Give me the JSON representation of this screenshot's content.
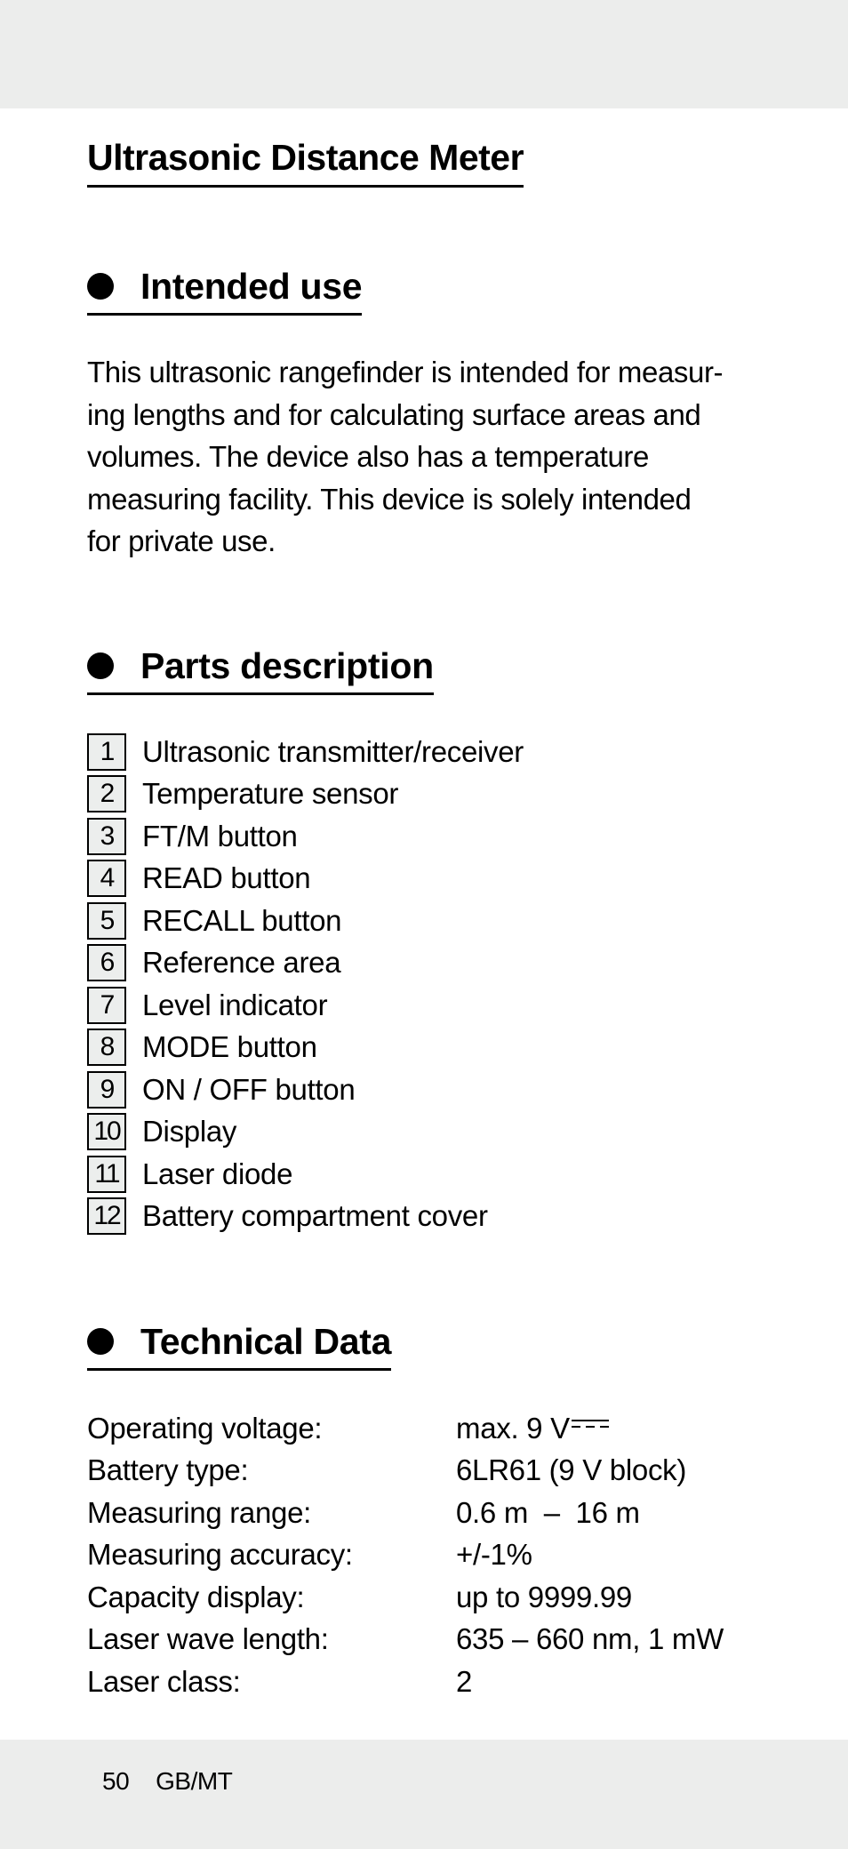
{
  "title": "Ultrasonic Distance Meter",
  "sections": {
    "intended_use": {
      "heading": "Intended use",
      "lines": [
        "This ultrasonic rangefinder is intended for measur-",
        "ing lengths and for calculating surface areas and",
        "volumes. The device also has a temperature",
        "measuring facility. This device is solely intended",
        "for private use."
      ]
    },
    "parts_description": {
      "heading": "Parts description",
      "items": [
        {
          "num": "1",
          "label": "Ultrasonic transmitter/receiver"
        },
        {
          "num": "2",
          "label": "Temperature sensor"
        },
        {
          "num": "3",
          "label": "FT/M button"
        },
        {
          "num": "4",
          "label": "READ button"
        },
        {
          "num": "5",
          "label": "RECALL button"
        },
        {
          "num": "6",
          "label": "Reference area"
        },
        {
          "num": "7",
          "label": "Level indicator"
        },
        {
          "num": "8",
          "label": "MODE button"
        },
        {
          "num": "9",
          "label": "ON / OFF button"
        },
        {
          "num": "10",
          "label": "Display"
        },
        {
          "num": "11",
          "label": "Laser diode"
        },
        {
          "num": "12",
          "label": "Battery compartment cover"
        }
      ]
    },
    "technical_data": {
      "heading": "Technical Data",
      "rows": [
        {
          "label": "Operating voltage:",
          "value": "max. 9 V",
          "icon": "dc-current-symbol"
        },
        {
          "label": "Battery type:",
          "value": "6LR61 (9 V block)"
        },
        {
          "label": "Measuring range:",
          "value": "0.6 m  –  16 m"
        },
        {
          "label": "Measuring accuracy:",
          "value": "+/-1%"
        },
        {
          "label": "Capacity display:",
          "value": "up to 9999.99"
        },
        {
          "label": "Laser wave length:",
          "value": "635 – 660 nm, 1 mW"
        },
        {
          "label": "Laser class:",
          "value": "2"
        }
      ]
    }
  },
  "footer": {
    "page_number": "50",
    "locale": "GB/MT"
  }
}
